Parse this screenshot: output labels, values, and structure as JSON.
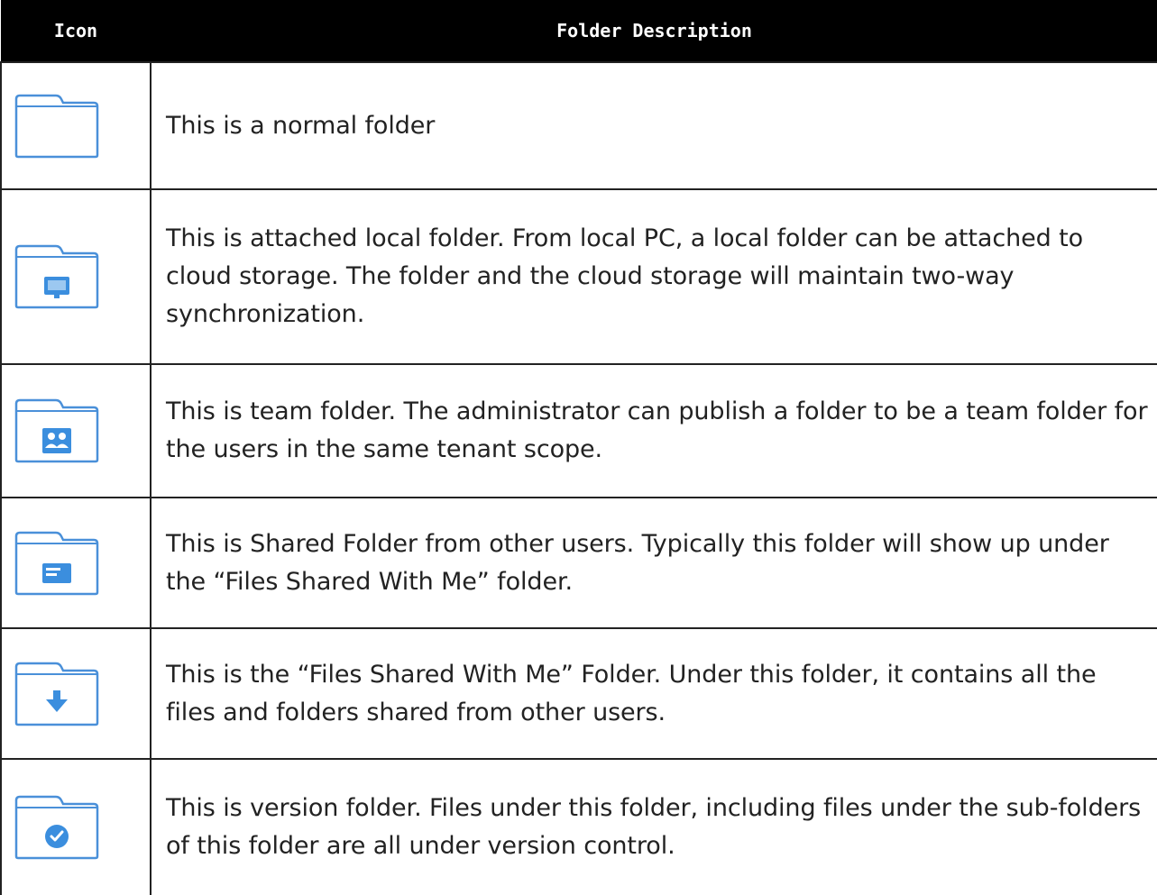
{
  "table": {
    "headers": {
      "icon": "Icon",
      "description": "Folder Description"
    },
    "rows": [
      {
        "icon": "folder-icon",
        "badge": "none",
        "description": "This is a normal folder"
      },
      {
        "icon": "attached-local-folder-icon",
        "badge": "monitor",
        "description": "This is attached local folder. From local PC, a local folder can be attached to cloud storage. The folder and the cloud storage will maintain two-way synchronization."
      },
      {
        "icon": "team-folder-icon",
        "badge": "users",
        "description": "This is team folder. The administrator can publish a folder to be a team folder for the users in the same tenant scope."
      },
      {
        "icon": "shared-folder-icon",
        "badge": "card",
        "description": "This is Shared Folder from other users. Typically this folder will show up under the “Files Shared With Me” folder."
      },
      {
        "icon": "files-shared-with-me-folder-icon",
        "badge": "arrow-down",
        "description": "This is the “Files Shared With Me” Folder. Under this folder, it contains all the files and folders shared from other users."
      },
      {
        "icon": "version-folder-icon",
        "badge": "check",
        "description": "This is version folder. Files under this folder, including files under the sub-folders of this folder are all under version control."
      }
    ]
  },
  "colors": {
    "folder_stroke": "#4a90d9",
    "folder_fill": "#ffffff",
    "badge_fill": "#3b8ede",
    "header_bg": "#000000",
    "header_text": "#ffffff",
    "body_text": "#222222"
  }
}
